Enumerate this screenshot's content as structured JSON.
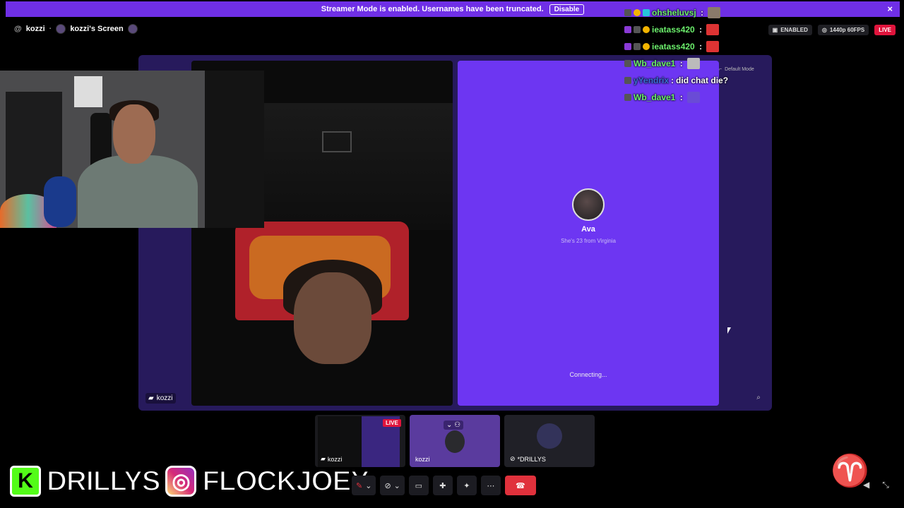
{
  "banner": {
    "text": "Streamer Mode is enabled. Usernames have been truncated.",
    "disable_label": "Disable",
    "close_icon": "×"
  },
  "header": {
    "user": "kozzi",
    "screen": "kozzi's Screen",
    "status_enabled": "ENABLED",
    "quality": "1440p 60FPS",
    "live": "LIVE"
  },
  "chat": [
    {
      "user": "ohsheluvsj",
      "color": "#6cf06c",
      "msg": "",
      "badges": [
        "mod",
        "gold",
        "cyan"
      ]
    },
    {
      "user": "ieatass420",
      "color": "#6cf06c",
      "msg": "",
      "badges": [
        "sub",
        "mod",
        "gold"
      ]
    },
    {
      "user": "ieatass420",
      "color": "#6cf06c",
      "msg": "",
      "badges": [
        "sub",
        "mod",
        "gold"
      ]
    },
    {
      "user": "Wb_dave1",
      "color": "#6cf06c",
      "msg": "",
      "badges": [
        "mod"
      ]
    },
    {
      "user": "yYendrix",
      "color": "#3a6fd8",
      "msg": "did chat die?",
      "badges": [
        "mod"
      ]
    },
    {
      "user": "Wb_dave1",
      "color": "#6cf06c",
      "msg": "",
      "badges": [
        "mod"
      ]
    }
  ],
  "stage": {
    "default_mode": "Default Mode",
    "left_label": "kozzi",
    "ava_name": "Ava",
    "ava_sub": "She's 23 from Virginia",
    "connecting": "Connecting..."
  },
  "thumbs": [
    {
      "label": "kozzi",
      "live": "LIVE"
    },
    {
      "label": "kozzi"
    },
    {
      "label": "*DRILLYS"
    }
  ],
  "brand": {
    "kick_text": "DRILLYS",
    "ig_text": "FLOCKJOEY"
  }
}
